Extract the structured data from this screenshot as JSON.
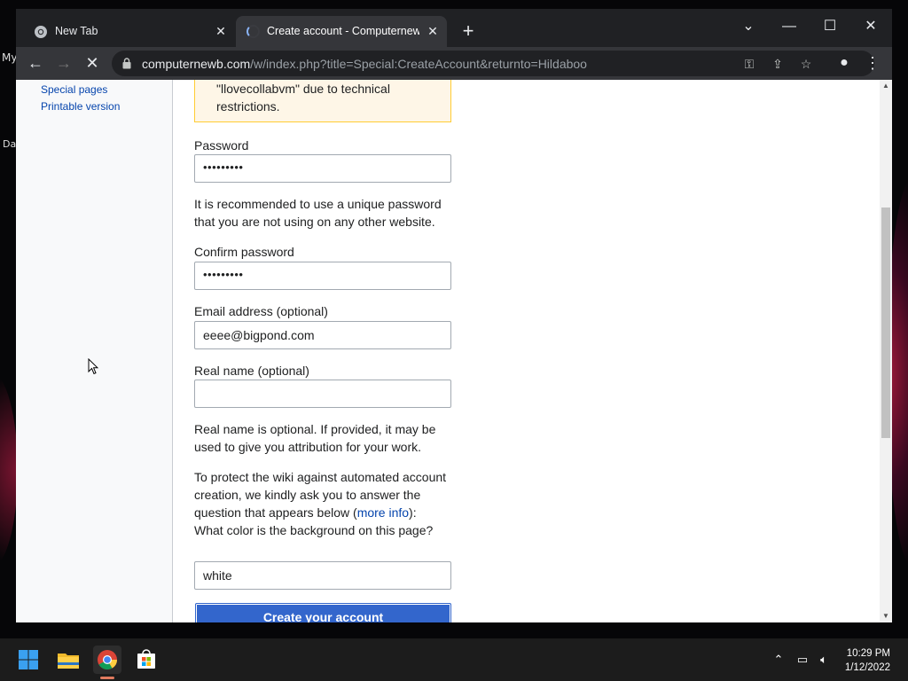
{
  "desktop": {
    "left_text_1": "My",
    "left_text_2": "Da"
  },
  "tabs": [
    {
      "title": "New Tab",
      "active": false
    },
    {
      "title": "Create account - Computernewb",
      "active": true
    }
  ],
  "address_bar": {
    "host": "computernewb.com",
    "path": "/w/index.php?title=Special:CreateAccount&returnto=Hildaboo"
  },
  "sidebar": {
    "items": [
      {
        "label": "Special pages"
      },
      {
        "label": "Printable version"
      }
    ]
  },
  "form": {
    "warning_line_1": "\"llovecollabvm\" due to technical",
    "warning_line_2": "restrictions.",
    "password_label": "Password",
    "password_value": "•••••••••",
    "password_hint": "It is recommended to use a unique password that you are not using on any other website.",
    "confirm_label": "Confirm password",
    "confirm_value": "•••••••••",
    "email_label": "Email address (optional)",
    "email_value": "eeee@bigpond.com",
    "realname_label": "Real name (optional)",
    "realname_value": "",
    "realname_hint": "Real name is optional. If provided, it may be used to give you attribution for your work.",
    "captcha_intro": "To protect the wiki against automated account creation, we kindly ask you to answer the question that appears below (",
    "captcha_more_info": "more info",
    "captcha_after": "):",
    "captcha_question": "What color is the background on this page?",
    "captcha_answer": "white",
    "submit_label": "Create your account"
  },
  "taskbar": {
    "time": "10:29 PM",
    "date": "1/12/2022"
  },
  "colors": {
    "accent_button": "#3366cc",
    "link": "#0645ad",
    "warning_bg": "#fef6e7"
  }
}
